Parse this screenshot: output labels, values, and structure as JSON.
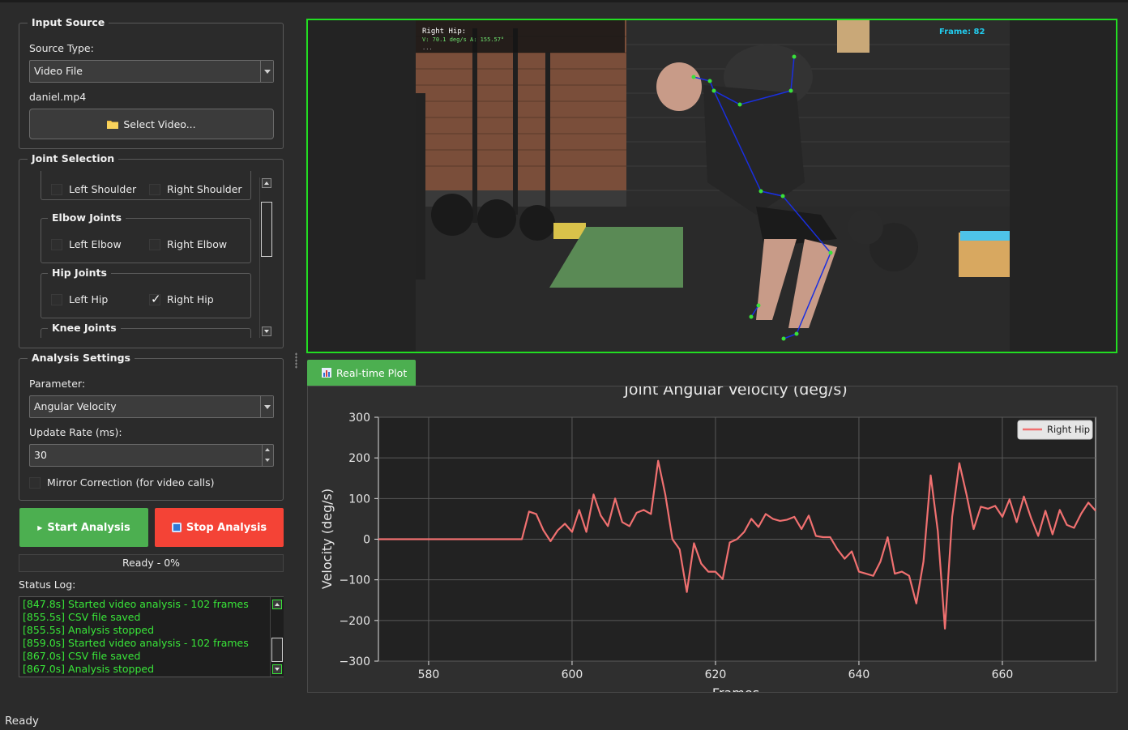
{
  "input_source": {
    "title": "Input Source",
    "source_type_label": "Source Type:",
    "source_type_value": "Video File",
    "file_name": "daniel.mp4",
    "select_button": "Select Video..."
  },
  "joint_selection": {
    "title": "Joint Selection",
    "shoulder": {
      "left": "Left Shoulder",
      "right": "Right Shoulder",
      "left_checked": false,
      "right_checked": false
    },
    "elbow": {
      "title": "Elbow Joints",
      "left": "Left Elbow",
      "right": "Right Elbow",
      "left_checked": false,
      "right_checked": false
    },
    "hip": {
      "title": "Hip Joints",
      "left": "Left Hip",
      "right": "Right Hip",
      "left_checked": false,
      "right_checked": true
    },
    "knee": {
      "title": "Knee Joints"
    }
  },
  "analysis_settings": {
    "title": "Analysis Settings",
    "parameter_label": "Parameter:",
    "parameter_value": "Angular Velocity",
    "update_rate_label": "Update Rate (ms):",
    "update_rate_value": "30",
    "mirror_label": "Mirror Correction (for video calls)"
  },
  "controls": {
    "start": "Start Analysis",
    "stop": "Stop Analysis",
    "start_color": "#4caf50",
    "stop_color": "#f44336",
    "progress_text": "Ready - 0%",
    "progress": 0
  },
  "status_log": {
    "label": "Status Log:",
    "lines": [
      "[847.8s] Started video analysis - 102 frames",
      "[855.5s] CSV file saved",
      "[855.5s] Analysis stopped",
      "[859.0s] Started video analysis - 102 frames",
      "[867.0s] CSV file saved",
      "[867.0s] Analysis stopped"
    ]
  },
  "video": {
    "overlay_line1": "Right Hip:",
    "overlay_line2": "V: 70.1 deg/s  A: 155.57°",
    "overlay_line3": "...",
    "frame_label": "Frame: 82",
    "border_color": "#22dd22"
  },
  "plot_tab": {
    "label": "Real-time Plot"
  },
  "chart_data": {
    "type": "line",
    "title": "Joint Angular Velocity (deg/s)",
    "xlabel": "Frames",
    "ylabel": "Velocity (deg/s)",
    "xlim": [
      573,
      673
    ],
    "ylim": [
      -300,
      300
    ],
    "xticks": [
      580,
      600,
      620,
      640,
      660
    ],
    "yticks": [
      300,
      200,
      100,
      0,
      -100,
      -200,
      -300
    ],
    "grid": true,
    "legend_position": "top-right",
    "series": [
      {
        "name": "Right Hip",
        "color": "#f07070",
        "points": [
          [
            573,
            0
          ],
          [
            580,
            0
          ],
          [
            590,
            0
          ],
          [
            593,
            0
          ],
          [
            594,
            68
          ],
          [
            595,
            62
          ],
          [
            596,
            22
          ],
          [
            597,
            -5
          ],
          [
            598,
            22
          ],
          [
            599,
            38
          ],
          [
            600,
            18
          ],
          [
            601,
            72
          ],
          [
            602,
            18
          ],
          [
            603,
            110
          ],
          [
            604,
            58
          ],
          [
            605,
            32
          ],
          [
            606,
            100
          ],
          [
            607,
            42
          ],
          [
            608,
            32
          ],
          [
            609,
            65
          ],
          [
            610,
            72
          ],
          [
            611,
            62
          ],
          [
            612,
            193
          ],
          [
            613,
            110
          ],
          [
            614,
            0
          ],
          [
            615,
            -25
          ],
          [
            616,
            -130
          ],
          [
            617,
            -10
          ],
          [
            618,
            -60
          ],
          [
            619,
            -80
          ],
          [
            620,
            -80
          ],
          [
            621,
            -98
          ],
          [
            622,
            -8
          ],
          [
            623,
            0
          ],
          [
            624,
            18
          ],
          [
            625,
            50
          ],
          [
            626,
            30
          ],
          [
            627,
            62
          ],
          [
            628,
            50
          ],
          [
            629,
            45
          ],
          [
            630,
            48
          ],
          [
            631,
            55
          ],
          [
            632,
            25
          ],
          [
            633,
            58
          ],
          [
            634,
            8
          ],
          [
            635,
            5
          ],
          [
            636,
            5
          ],
          [
            637,
            -25
          ],
          [
            638,
            -48
          ],
          [
            639,
            -30
          ],
          [
            640,
            -80
          ],
          [
            641,
            -85
          ],
          [
            642,
            -90
          ],
          [
            643,
            -55
          ],
          [
            644,
            5
          ],
          [
            645,
            -85
          ],
          [
            646,
            -80
          ],
          [
            647,
            -90
          ],
          [
            648,
            -158
          ],
          [
            649,
            -55
          ],
          [
            650,
            157
          ],
          [
            651,
            20
          ],
          [
            652,
            -220
          ],
          [
            653,
            55
          ],
          [
            654,
            187
          ],
          [
            655,
            110
          ],
          [
            656,
            25
          ],
          [
            657,
            80
          ],
          [
            658,
            75
          ],
          [
            659,
            82
          ],
          [
            660,
            55
          ],
          [
            661,
            98
          ],
          [
            662,
            42
          ],
          [
            663,
            105
          ],
          [
            664,
            52
          ],
          [
            665,
            8
          ],
          [
            666,
            70
          ],
          [
            667,
            12
          ],
          [
            668,
            72
          ],
          [
            669,
            35
          ],
          [
            670,
            28
          ],
          [
            671,
            63
          ],
          [
            672,
            90
          ],
          [
            673,
            70
          ]
        ]
      }
    ]
  },
  "status_bar": {
    "text": "Ready"
  }
}
